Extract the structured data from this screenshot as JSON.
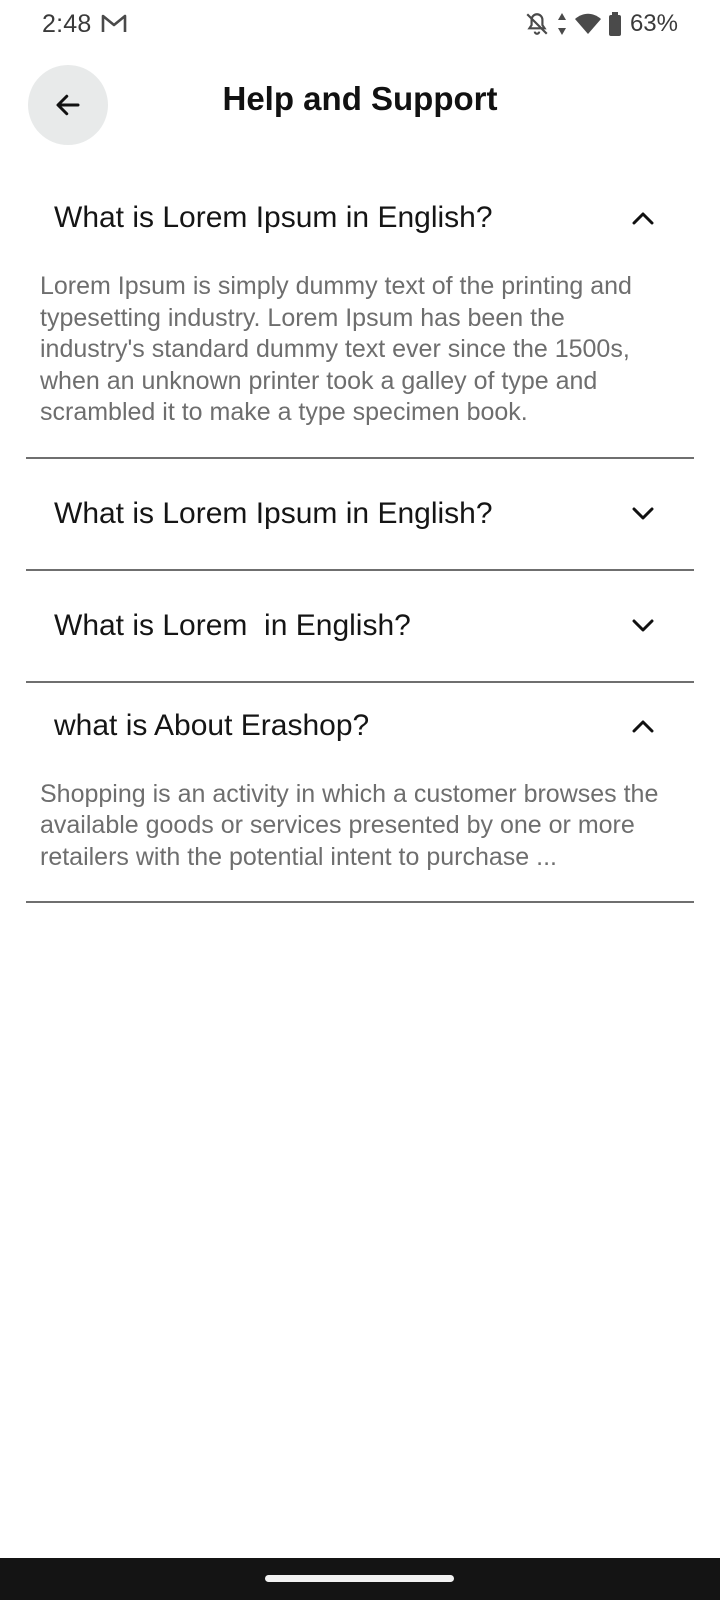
{
  "status_bar": {
    "time": "2:48",
    "battery": "63%",
    "icons": [
      "gmail-icon",
      "notifications-off-icon",
      "data-arrows-icon",
      "wifi-icon",
      "battery-icon"
    ]
  },
  "header": {
    "title": "Help and Support",
    "back_icon": "arrow-left-icon"
  },
  "faq": [
    {
      "question": "What is Lorem Ipsum in English?",
      "expanded": true,
      "answer": "Lorem Ipsum is simply dummy text of the printing and typesetting industry. Lorem Ipsum has been the industry's standard dummy text ever since the 1500s, when an unknown printer took a galley of type and scrambled it to make a type specimen book."
    },
    {
      "question": "What is Lorem Ipsum in English?",
      "expanded": false
    },
    {
      "question": "What is Lorem  in English?",
      "expanded": false
    },
    {
      "question": "what is About Erashop?",
      "expanded": true,
      "answer": "Shopping is an activity in which a customer browses the available goods or services presented by one or more retailers with the potential intent to purchase ..."
    }
  ],
  "colors": {
    "back_button_bg": "#e8eaea",
    "divider": "#6f6f6f",
    "answer_text": "#6e6e6e",
    "nav_bar": "#141414"
  }
}
